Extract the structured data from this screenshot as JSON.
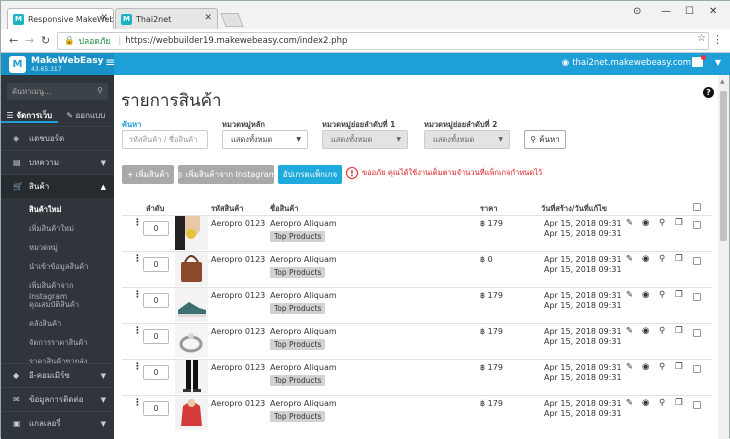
{
  "browser": {
    "tabs": [
      {
        "title": "Responsive MakeWebEasy",
        "favicon": "MWE"
      },
      {
        "title": "Thai2net",
        "favicon": "MWE"
      }
    ],
    "secure_label": "ปลอดภัย",
    "url": "https://webbuilder19.makewebeasy.com/index2.php"
  },
  "header": {
    "brand": "MakeWebEasy",
    "ip": "43.65.317",
    "site": "thai2net.makewebeasy.com",
    "accent": "#1e9fd8"
  },
  "sidebar": {
    "search_placeholder": "ค้นหาเมนู...",
    "tabs": [
      "จัดการเว็บ",
      "ออกแบบ"
    ],
    "items": [
      {
        "label": "แดชบอร์ด",
        "icon": "dashboard-icon"
      },
      {
        "label": "บทความ",
        "icon": "article-icon"
      },
      {
        "label": "สินค้า",
        "icon": "cart-icon"
      },
      {
        "label": "อี-คอมเมิร์ซ",
        "icon": "tag-icon"
      },
      {
        "label": "ข้อมูลการติดต่อ",
        "icon": "envelope-icon"
      },
      {
        "label": "แกลเลอรี่",
        "icon": "gallery-icon"
      }
    ],
    "submenu": [
      "สินค้าใหม่",
      "เพิ่มสินค้าใหม่",
      "หมวดหมู่",
      "นำเข้าข้อมูลสินค้า",
      "เพิ่มสินค้าจาก Instagram",
      "คุณสมบัติสินค้า",
      "คลังสินค้า",
      "จัดการราคาสินค้า",
      "ราคาสินค้าขายส่ง"
    ]
  },
  "page": {
    "title": "รายการสินค้า",
    "filters": {
      "search_label": "ค้นหา",
      "search_placeholder": "รหัสสินค้า / ชื่อสินค้า",
      "cat_main_label": "หมวดหมู่หลัก",
      "cat_sub1_label": "หมวดหมู่ย่อยลำดับที่ 1",
      "cat_sub2_label": "หมวดหมู่ย่อยลำดับที่ 2",
      "show_all": "แสดงทั้งหมด",
      "search_button": "ค้นหา"
    },
    "actions": {
      "add_product": "เพิ่มสินค้า",
      "add_instagram": "เพิ่มสินค้าจาก Instagram",
      "upgrade": "อัปเกรดแพ็กเกจ",
      "warning": "ขออภัย คุณได้ใช้งานเต็มตามจำนวนที่แพ็กเกจกำหนดไว้"
    },
    "table": {
      "headers": {
        "order": "ลำดับ",
        "code": "รหัสสินค้า",
        "name": "ชื่อสินค้า",
        "price": "ราคา",
        "date": "วันที่สร้าง/วันที่แก้ไข"
      },
      "rows": [
        {
          "order": "0",
          "code": "Aeropro 0123",
          "name": "Aeropro Aliquam",
          "tag": "Top Products",
          "price": "฿ 179",
          "created": "Apr 15, 2018 09:31",
          "modified": "Apr 15, 2018 09:31",
          "image": "necklace"
        },
        {
          "order": "0",
          "code": "Aeropro 0123",
          "name": "Aeropro Aliquam",
          "tag": "Top Products",
          "price": "฿ 0",
          "created": "Apr 15, 2018 09:31",
          "modified": "Apr 15, 2018 09:31",
          "image": "handbag"
        },
        {
          "order": "0",
          "code": "Aeropro 0123",
          "name": "Aeropro Aliquam",
          "tag": "Top Products",
          "price": "฿ 179",
          "created": "Apr 15, 2018 09:31",
          "modified": "Apr 15, 2018 09:31",
          "image": "shoe"
        },
        {
          "order": "0",
          "code": "Aeropro 0123",
          "name": "Aeropro Aliquam",
          "tag": "Top Products",
          "price": "฿ 179",
          "created": "Apr 15, 2018 09:31",
          "modified": "Apr 15, 2018 09:31",
          "image": "ring"
        },
        {
          "order": "0",
          "code": "Aeropro 0123",
          "name": "Aeropro Aliquam",
          "tag": "Top Products",
          "price": "฿ 179",
          "created": "Apr 15, 2018 09:31",
          "modified": "Apr 15, 2018 09:31",
          "image": "legs"
        },
        {
          "order": "0",
          "code": "Aeropro 0123",
          "name": "Aeropro Aliquam",
          "tag": "Top Products",
          "price": "฿ 179",
          "created": "Apr 15, 2018 09:31",
          "modified": "Apr 15, 2018 09:31",
          "image": "hoodie"
        }
      ]
    }
  }
}
